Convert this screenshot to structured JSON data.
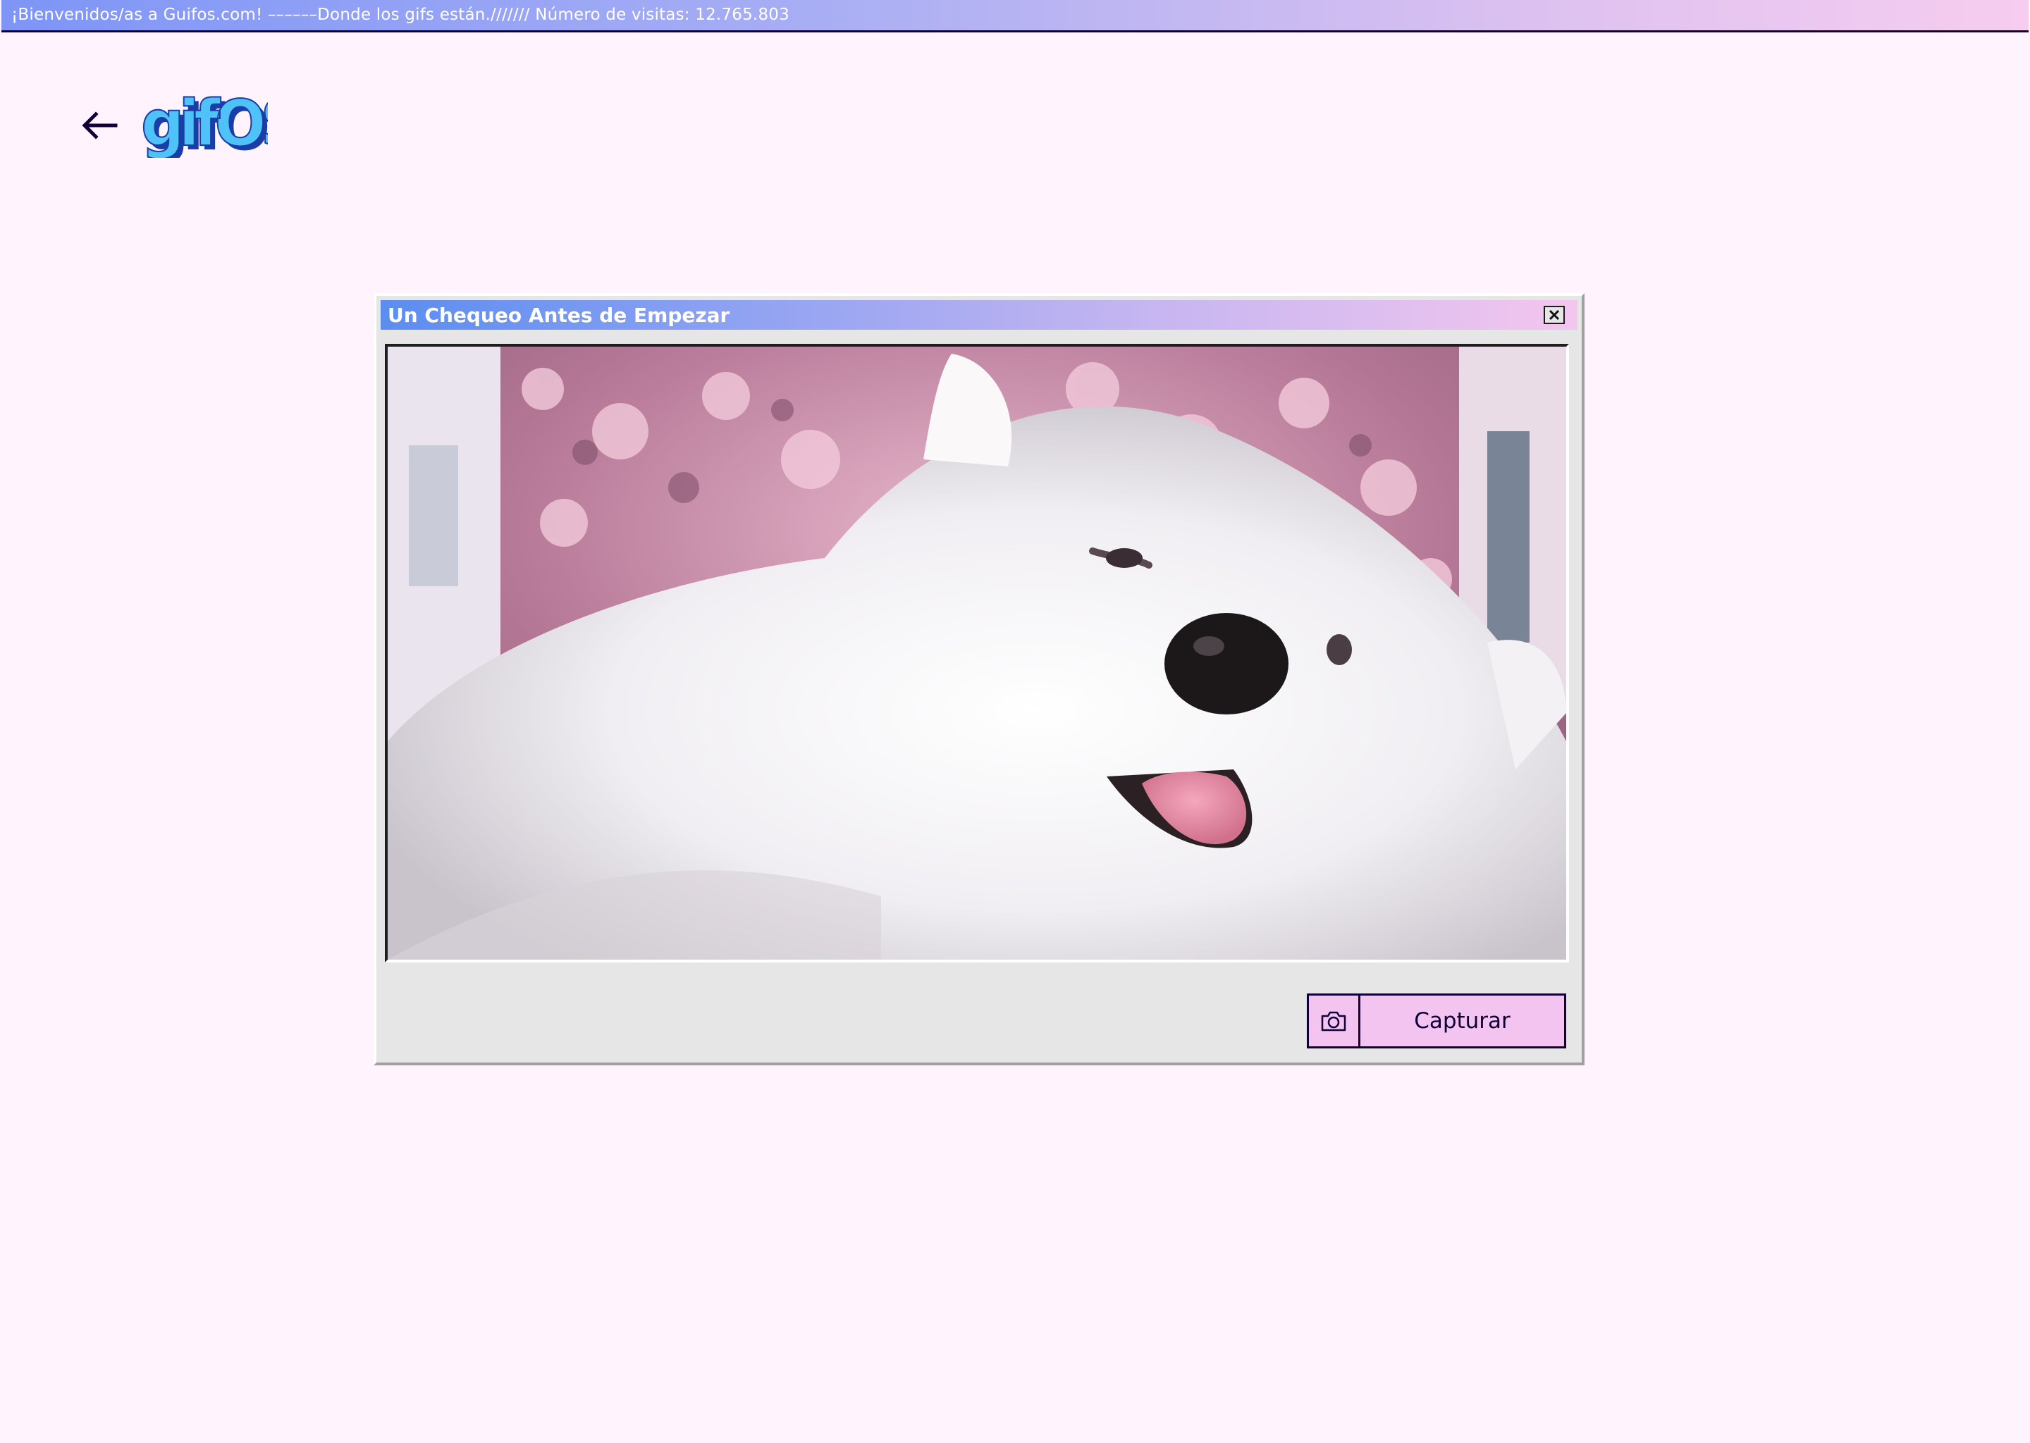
{
  "topbar": {
    "text": "¡Bienvenidos/as a Guifos.com! ––––––Donde los gifs están./////// Número de visitas: 12.765.803"
  },
  "header": {
    "back_icon": "arrow-left-icon",
    "logo_text": "gifOS"
  },
  "dialog": {
    "title": "Un Chequeo Antes de Empezar",
    "close_icon": "close-icon",
    "preview_image": "white samoyed dog under pink cherry blossoms",
    "camera_icon": "camera-icon",
    "capture_label": "Capturar"
  },
  "colors": {
    "page_background": "#FFF4FD",
    "accent_pink": "#F3C4F0",
    "dark_navy": "#110038",
    "gradient_blue": "#5B8DF0",
    "gradient_pink": "#F3C6EE"
  }
}
